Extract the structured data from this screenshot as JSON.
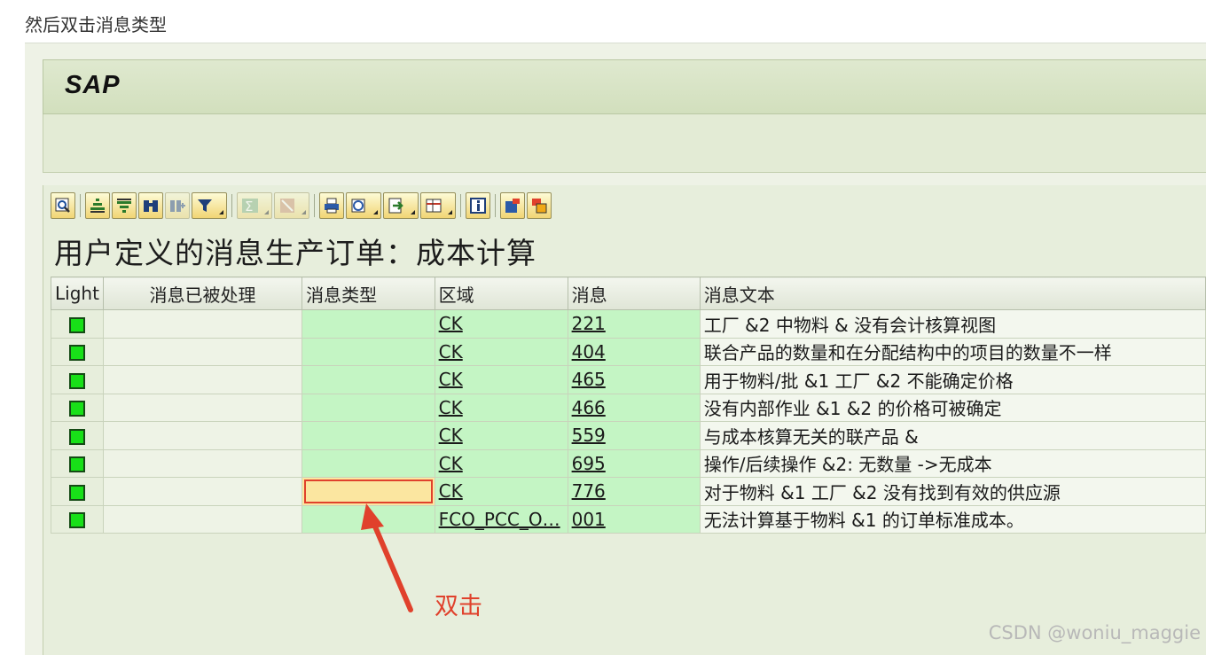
{
  "blog": {
    "caption": "然后双击消息类型"
  },
  "sap": {
    "logo": "SAP",
    "page_title": "用户定义的消息生产订单：成本计算",
    "toolbar": [
      {
        "icon": "details-magnifier-icon",
        "type": "button"
      },
      {
        "icon": "sort-ascending-icon",
        "type": "button"
      },
      {
        "icon": "sort-descending-icon",
        "type": "button"
      },
      {
        "icon": "find-binoculars-icon",
        "type": "button"
      },
      {
        "icon": "find-next-icon",
        "type": "button",
        "disabled": true
      },
      {
        "icon": "filter-icon",
        "type": "dropdown"
      },
      {
        "icon": "sum-icon",
        "type": "dropdown",
        "disabled": true
      },
      {
        "icon": "subtotal-icon",
        "type": "dropdown",
        "disabled": true
      },
      {
        "icon": "print-preview-icon",
        "type": "button"
      },
      {
        "icon": "views-icon",
        "type": "dropdown"
      },
      {
        "icon": "export-icon",
        "type": "dropdown"
      },
      {
        "icon": "layout-icon",
        "type": "dropdown"
      },
      {
        "icon": "info-icon",
        "type": "button"
      },
      {
        "icon": "graphic-icon",
        "type": "button"
      },
      {
        "icon": "windows-icon",
        "type": "button"
      }
    ]
  },
  "table": {
    "headers": {
      "light": "Light",
      "processed": "消息已被处理",
      "msgtype": "消息类型",
      "area": "区域",
      "msgno": "消息",
      "msgtext": "消息文本"
    },
    "rows": [
      {
        "status": "green",
        "processed": "",
        "msgtype": "",
        "area": "CK",
        "msgno": "221",
        "text": "工厂 &2 中物料 & 没有会计核算视图"
      },
      {
        "status": "green",
        "processed": "",
        "msgtype": "",
        "area": "CK",
        "msgno": "404",
        "text": "联合产品的数量和在分配结构中的项目的数量不一样"
      },
      {
        "status": "green",
        "processed": "",
        "msgtype": "",
        "area": "CK",
        "msgno": "465",
        "text": "用于物料/批 &1 工厂 &2 不能确定价格"
      },
      {
        "status": "green",
        "processed": "",
        "msgtype": "",
        "area": "CK",
        "msgno": "466",
        "text": "没有内部作业 &1 &2 的价格可被确定"
      },
      {
        "status": "green",
        "processed": "",
        "msgtype": "",
        "area": "CK",
        "msgno": "559",
        "text": "与成本核算无关的联产品 &"
      },
      {
        "status": "green",
        "processed": "",
        "msgtype": "",
        "area": "CK",
        "msgno": "695",
        "text": "操作/后续操作 &2: 无数量 ->无成本"
      },
      {
        "status": "green",
        "processed": "",
        "msgtype": "",
        "area": "CK",
        "msgno": "776",
        "text": "对于物料 &1 工厂 &2 没有找到有效的供应源",
        "selected": true
      },
      {
        "status": "green",
        "processed": "",
        "msgtype": "",
        "area": "FCO_PCC_O…",
        "msgno": "001",
        "text": "无法计算基于物料 &1 的订单标准成本。"
      }
    ]
  },
  "annotation": {
    "label": "双击",
    "color": "#e0412c"
  },
  "watermark": "CSDN @woniu_maggie"
}
